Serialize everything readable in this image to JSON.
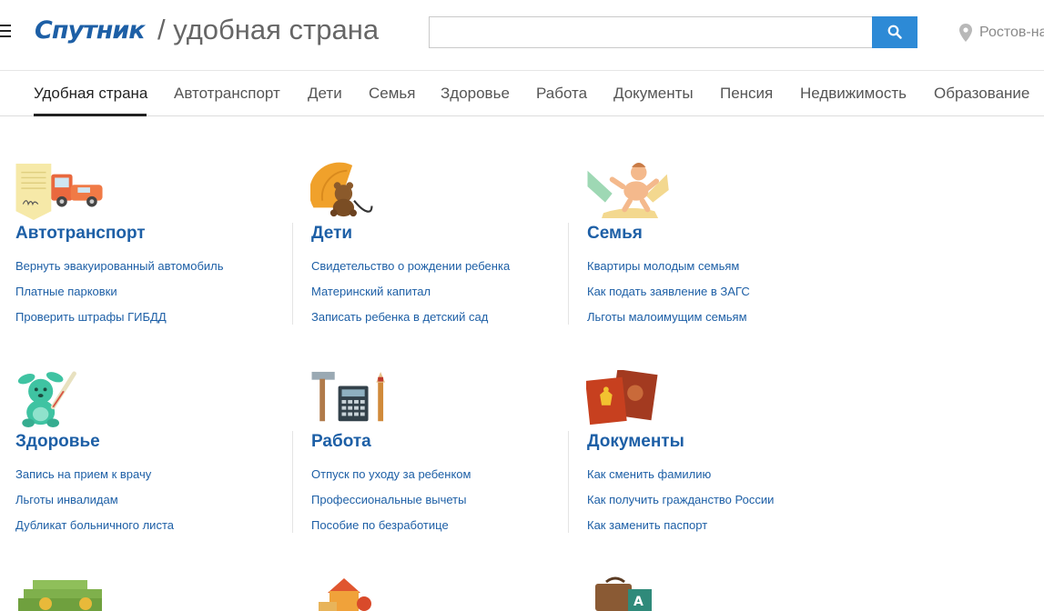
{
  "header": {
    "logo": "Спутник",
    "title": "/ удобная страна",
    "search_placeholder": "",
    "location": "Ростов-на-Дону"
  },
  "tabs": [
    {
      "label": "Удобная страна",
      "active": true
    },
    {
      "label": "Автотранспорт"
    },
    {
      "label": "Дети"
    },
    {
      "label": "Семья"
    },
    {
      "label": "Здоровье"
    },
    {
      "label": "Работа"
    },
    {
      "label": "Документы"
    },
    {
      "label": "Пенсия"
    },
    {
      "label": "Недвижимость"
    },
    {
      "label": "Образование"
    }
  ],
  "sections": [
    {
      "title": "Автотранспорт",
      "icon": "car-document-icon",
      "links": [
        "Вернуть эвакуированный автомобиль",
        "Платные парковки",
        "Проверить штрафы ГИБДД"
      ]
    },
    {
      "title": "Дети",
      "icon": "teddy-bear-umbrella-icon",
      "links": [
        "Свидетельство о рождении ребенка",
        "Материнский капитал",
        "Записать ребенка в детский сад"
      ]
    },
    {
      "title": "Семья",
      "icon": "baby-hands-icon",
      "links": [
        "Квартиры молодым семьям",
        "Как подать заявление в ЗАГС",
        "Льготы малоимущим семьям"
      ]
    },
    {
      "title": "Здоровье",
      "icon": "bunny-thermometer-icon",
      "links": [
        "Запись на прием к врачу",
        "Льготы инвалидам",
        "Дубликат больничного листа"
      ]
    },
    {
      "title": "Работа",
      "icon": "tools-calculator-icon",
      "links": [
        "Отпуск по уходу за ребенком",
        "Профессиональные вычеты",
        "Пособие по безработице"
      ]
    },
    {
      "title": "Документы",
      "icon": "passports-icon",
      "links": [
        "Как сменить фамилию",
        "Как получить гражданство России",
        "Как заменить паспорт"
      ]
    }
  ],
  "bottom_icons": [
    "money-coins-icon",
    "house-icon",
    "school-bag-icon"
  ],
  "colors": {
    "brand": "#1d5fa6",
    "search_button": "#2d8ad6"
  }
}
